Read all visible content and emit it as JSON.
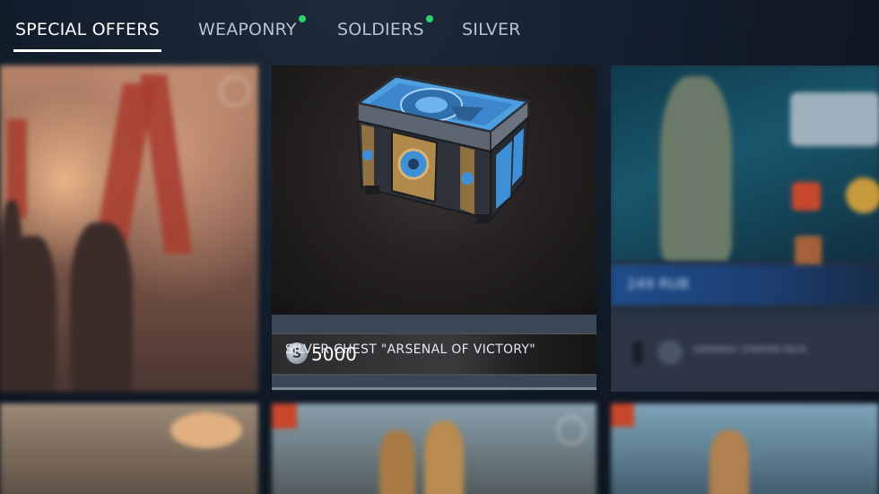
{
  "tabs": [
    {
      "label": "SPECIAL OFFERS",
      "active": true,
      "has_notification": false
    },
    {
      "label": "WEAPONRY",
      "active": false,
      "has_notification": true
    },
    {
      "label": "SOLDIERS",
      "active": false,
      "has_notification": true
    },
    {
      "label": "SILVER",
      "active": false,
      "has_notification": false
    }
  ],
  "featured_offer": {
    "price": "5000",
    "currency_icon": "silver-coin-icon",
    "currency_symbol": "S",
    "item_name": "SILVER CHEST \"ARSENAL OF VICTORY\""
  },
  "right_offer": {
    "price": "249 RUB",
    "item_name": "GERMANY STARTER PACK"
  },
  "colors": {
    "notification": "#2bd46b",
    "background": "#101a27",
    "chest_blue": "#3f8fd6",
    "chest_gold": "#b08a4a"
  }
}
